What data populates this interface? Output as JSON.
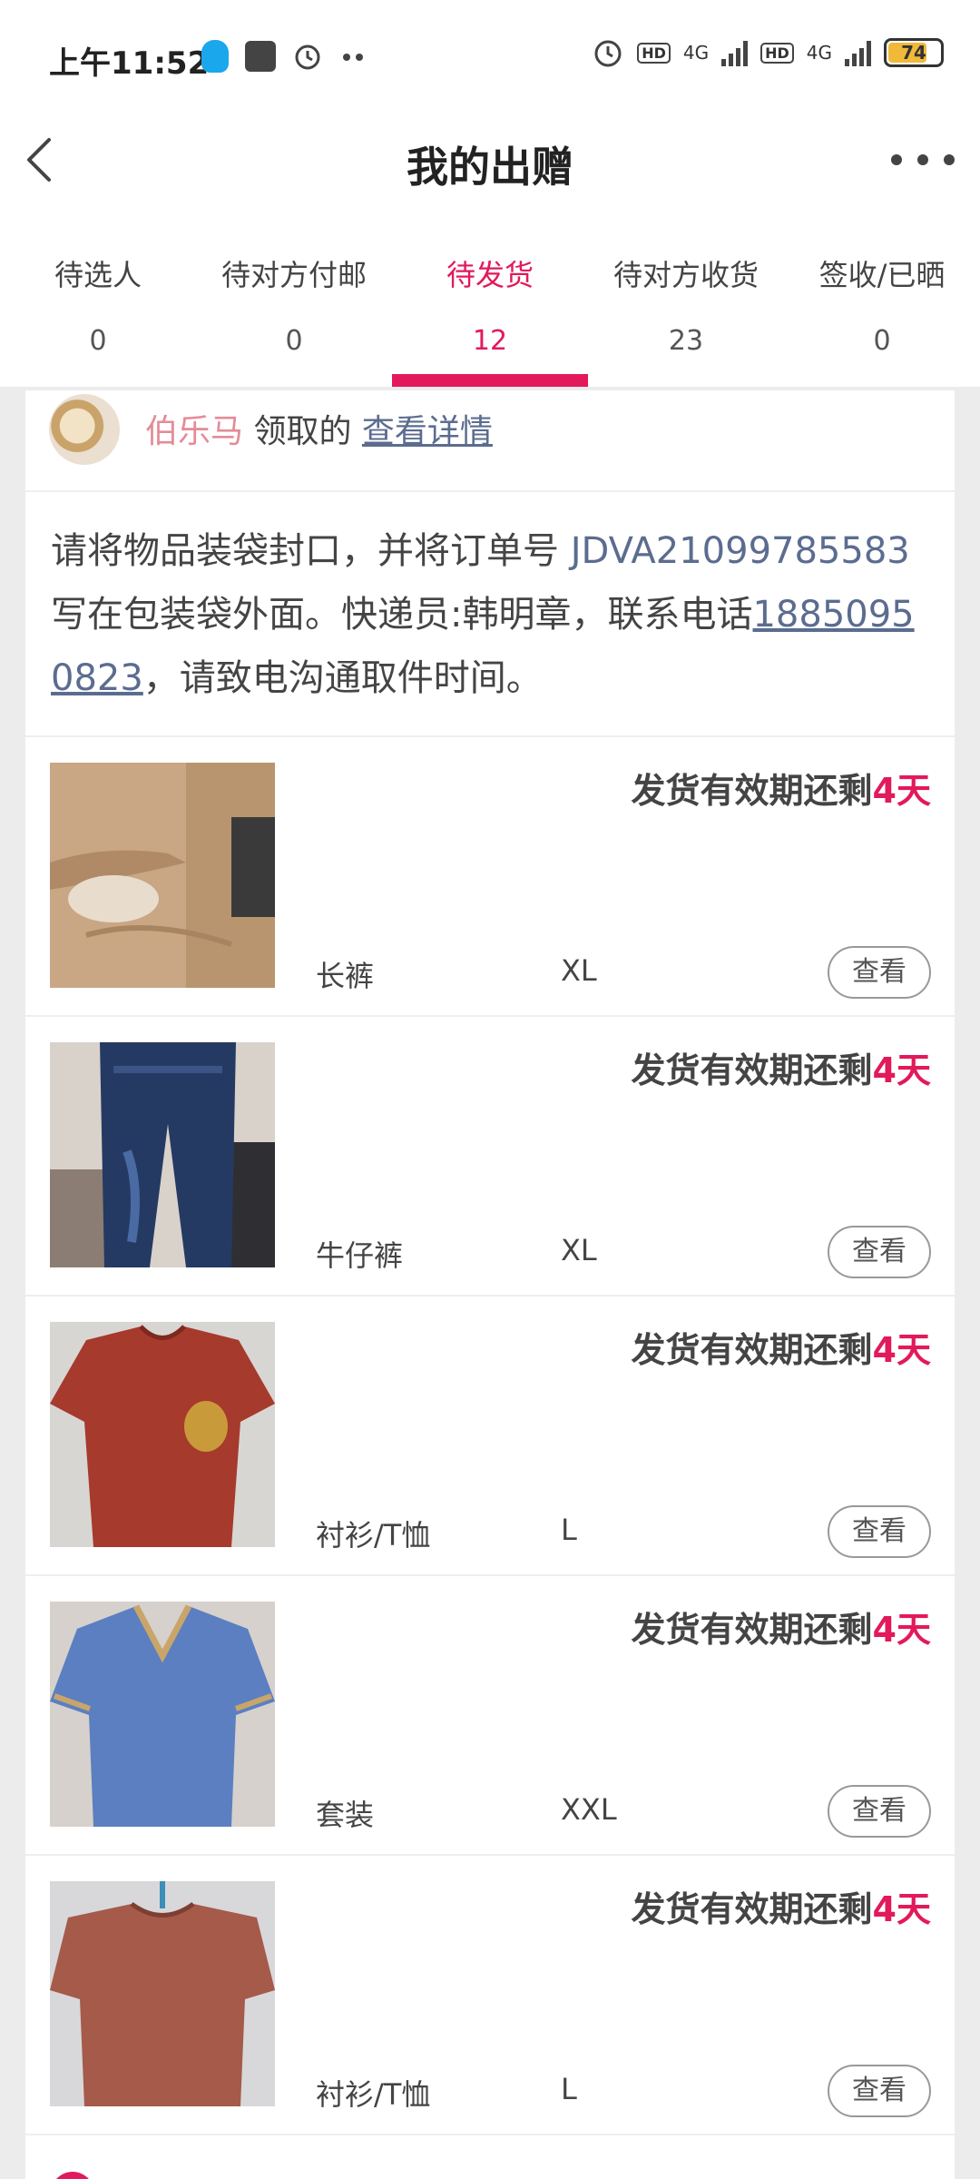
{
  "status_bar": {
    "time": "上午11:52",
    "hd1": "HD",
    "net1": "4G",
    "hd2": "HD",
    "net2": "4G",
    "battery": "74"
  },
  "header": {
    "title": "我的出赠"
  },
  "tabs": [
    {
      "label": "待选人",
      "count": "0"
    },
    {
      "label": "待对方付邮",
      "count": "0"
    },
    {
      "label": "待发货",
      "count": "12",
      "active": true
    },
    {
      "label": "待对方收货",
      "count": "23"
    },
    {
      "label": "签收/已晒",
      "count": "0"
    }
  ],
  "claim": {
    "user": "伯乐马",
    "text": " 领取的 ",
    "link": "查看详情"
  },
  "notice": {
    "text1": "请将物品装袋封口，并将订单号 ",
    "order_no": "JDVA21099785583",
    "text2": " 写在包装袋外面。快递员:韩明章，联系电话",
    "phone": "18850950823",
    "text3": "，请致电沟通取件时间。"
  },
  "items": [
    {
      "deadline_prefix": "发货有效期还剩",
      "days": "4天",
      "name": "长裤",
      "size": "XL",
      "button": "查看"
    },
    {
      "deadline_prefix": "发货有效期还剩",
      "days": "4天",
      "name": "牛仔裤",
      "size": "XL",
      "button": "查看"
    },
    {
      "deadline_prefix": "发货有效期还剩",
      "days": "4天",
      "name": "衬衫/T恤",
      "size": "L",
      "button": "查看"
    },
    {
      "deadline_prefix": "发货有效期还剩",
      "days": "4天",
      "name": "套装",
      "size": "XXL",
      "button": "查看"
    },
    {
      "deadline_prefix": "发货有效期还剩",
      "days": "4天",
      "name": "衬衫/T恤",
      "size": "L",
      "button": "查看"
    }
  ],
  "colors": {
    "accent": "#e2195a",
    "link": "#5b6c8f"
  }
}
